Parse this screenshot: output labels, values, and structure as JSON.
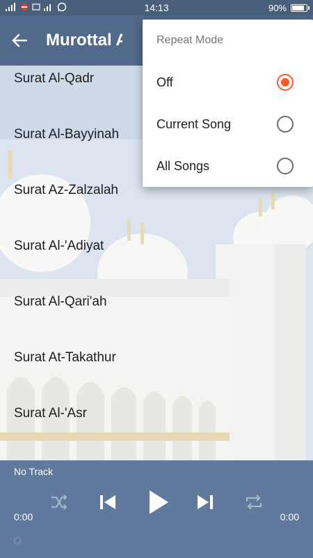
{
  "status_bar": {
    "time": "14:13",
    "battery": "90%",
    "battery_level": 0.9
  },
  "app_bar": {
    "title": "Murottal A"
  },
  "songs": [
    "Surat Al-Qadr",
    "Surat Al-Bayyinah",
    "Surat Az-Zalzalah",
    "Surat Al-'Adiyat",
    "Surat Al-Qari'ah",
    "Surat At-Takathur",
    "Surat Al-'Asr"
  ],
  "player": {
    "track": "No Track",
    "elapsed": "0:00",
    "duration": "0:00"
  },
  "repeat_menu": {
    "title": "Repeat Mode",
    "options": [
      "Off",
      "Current Song",
      "All Songs"
    ],
    "selected": "Off"
  },
  "colors": {
    "app_bar": "#4a6386",
    "accent": "#ff5722",
    "player": "#567096"
  }
}
